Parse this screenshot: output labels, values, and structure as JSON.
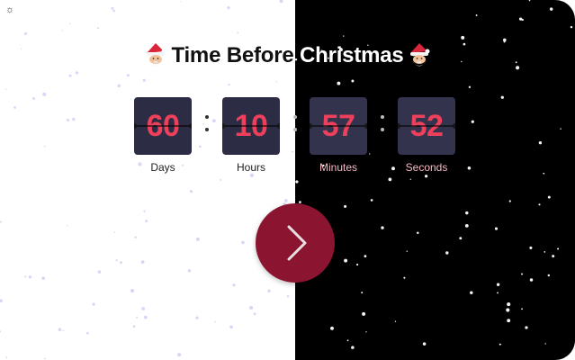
{
  "title": "Time Before Christmas",
  "icons": {
    "theme_toggle": "gear-icon",
    "title_left": "santa-icon",
    "title_right": "santa-icon",
    "next": "chevron-right-icon"
  },
  "countdown": {
    "days": {
      "value": "60",
      "label": "Days"
    },
    "hours": {
      "value": "10",
      "label": "Hours"
    },
    "minutes": {
      "value": "57",
      "label": "Minutes"
    },
    "seconds": {
      "value": "52",
      "label": "Seconds"
    }
  },
  "colors": {
    "light_background": "#ffffff",
    "dark_background": "#000000",
    "card_background": "#2c2d44",
    "digit_color": "#ee3f5b",
    "button_color": "#8b1530",
    "dark_label_color": "#f6b9c3"
  }
}
